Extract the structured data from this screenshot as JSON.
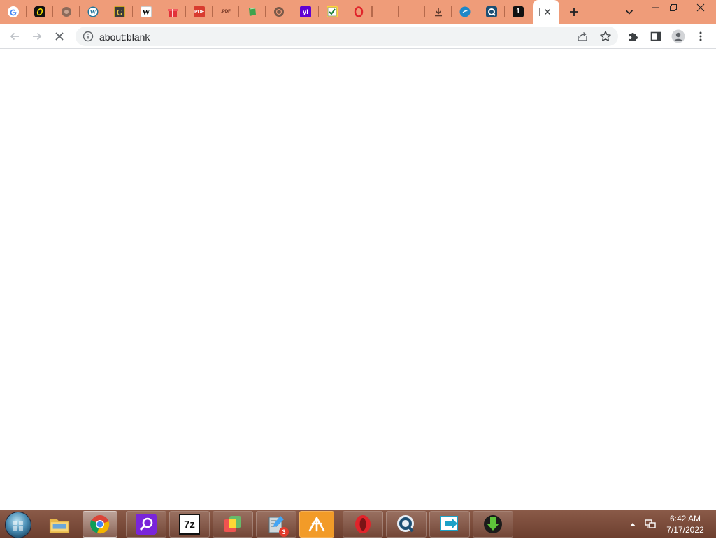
{
  "browser": {
    "tabs": [
      {
        "icon": "google-icon",
        "glyph": "G",
        "color": "#ffffff"
      },
      {
        "icon": "black-rounded-app-icon",
        "glyph": "0",
        "color": "#111111"
      },
      {
        "icon": "globe-icon",
        "glyph": "",
        "color": "#8b6a5a"
      },
      {
        "icon": "wordpress-icon",
        "glyph": "W",
        "color": "#21759b"
      },
      {
        "icon": "grammarly-style-g-icon",
        "glyph": "G",
        "color": "#3a3a3a"
      },
      {
        "icon": "wikipedia-icon",
        "glyph": "W",
        "color": "#ffffff"
      },
      {
        "icon": "gift-icon",
        "glyph": "",
        "color": "#e2333a"
      },
      {
        "icon": "pdf-red-icon",
        "glyph": "PDF",
        "color": "#d83b2f"
      },
      {
        "icon": "pdf-orange-icon",
        "glyph": ".PDF",
        "color": "#ef9c79"
      },
      {
        "icon": "green-book-icon",
        "glyph": "",
        "color": "#3fa34d"
      },
      {
        "icon": "chrome-gray-icon",
        "glyph": "",
        "color": "#7a5a4a"
      },
      {
        "icon": "yahoo-icon",
        "glyph": "y!",
        "color": "#6001d2"
      },
      {
        "icon": "checklist-icon",
        "glyph": "✓",
        "color": "#fdd835"
      },
      {
        "icon": "opera-icon",
        "glyph": "O",
        "color": "#ef9c79"
      },
      {
        "icon": "blank-tab-icon",
        "glyph": "",
        "color": ""
      },
      {
        "icon": "blank-tab-icon",
        "glyph": "",
        "color": ""
      },
      {
        "icon": "download-arrow-icon",
        "glyph": "↓",
        "color": "#ef9c79"
      },
      {
        "icon": "blue-circle-app-icon",
        "glyph": "",
        "color": "#1e88c9"
      },
      {
        "icon": "q-search-icon",
        "glyph": "Q",
        "color": "#1c4f74"
      },
      {
        "icon": "one-icon",
        "glyph": "1",
        "color": "#111111"
      }
    ],
    "active_tab": {
      "close_icon": "close-icon"
    },
    "address": {
      "url": "about:blank"
    },
    "colors": {
      "tabstrip": "#ef9c79",
      "toolbar": "#ffffff",
      "omnibox": "#f1f3f4"
    }
  },
  "taskbar": {
    "items": [
      {
        "name": "explorer",
        "icon": "folder-icon"
      },
      {
        "name": "chrome",
        "icon": "chrome-icon",
        "active": true
      },
      {
        "name": "search-app",
        "icon": "magnifier-app-icon"
      },
      {
        "name": "7zip",
        "icon": "7zip-icon",
        "label": "7z"
      },
      {
        "name": "office-app",
        "icon": "colored-squares-icon"
      },
      {
        "name": "compose-app",
        "icon": "pencil-doc-icon",
        "badge": "3"
      },
      {
        "name": "avast-app",
        "icon": "sun-rays-icon"
      },
      {
        "name": "opera",
        "icon": "opera-icon"
      },
      {
        "name": "q-search",
        "icon": "q-search-icon"
      },
      {
        "name": "remote",
        "icon": "arrow-screen-icon"
      },
      {
        "name": "downloader",
        "icon": "green-download-icon"
      }
    ],
    "clock": {
      "time": "6:42 AM",
      "date": "7/17/2022"
    }
  }
}
